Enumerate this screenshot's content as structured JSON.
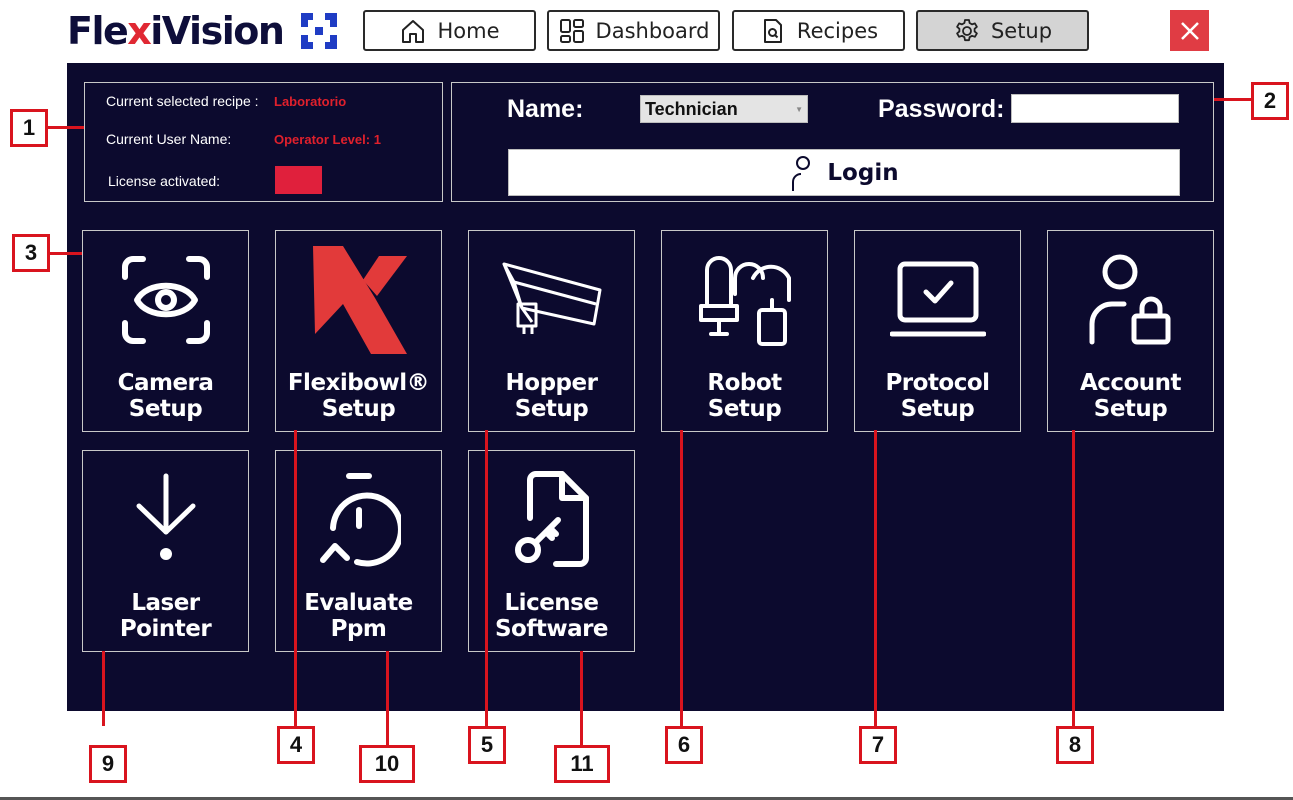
{
  "app": {
    "logo_text_part1": "Fle",
    "logo_text_x": "x",
    "logo_text_part2": "iVision",
    "brand_color": "#e02833",
    "panel_color": "#0c0a2e"
  },
  "nav": {
    "items": [
      {
        "label": "Home",
        "icon": "home-icon",
        "active": false
      },
      {
        "label": "Dashboard",
        "icon": "dashboard-icon",
        "active": false
      },
      {
        "label": "Recipes",
        "icon": "recipes-icon",
        "active": false
      },
      {
        "label": "Setup",
        "icon": "gear-icon",
        "active": true
      }
    ],
    "close_icon": "close-icon"
  },
  "info": {
    "recipe_label": "Current selected recipe :",
    "recipe_value": "Laboratorio",
    "user_label": "Current User Name:",
    "user_value": "Operator Level: 1",
    "license_label": "License activated:",
    "license_status_color": "#e0203c"
  },
  "login": {
    "name_label": "Name:",
    "name_value": "Technician",
    "password_label": "Password:",
    "password_value": "",
    "button_label": "Login",
    "button_icon": "user-icon"
  },
  "tiles": [
    {
      "line1": "Camera",
      "line2": "Setup",
      "icon": "camera-eye-icon"
    },
    {
      "line1": "Flexibowl®",
      "line2": "Setup",
      "icon": "flexibowl-logo-icon"
    },
    {
      "line1": "Hopper",
      "line2": "Setup",
      "icon": "hopper-icon"
    },
    {
      "line1": "Robot",
      "line2": "Setup",
      "icon": "robot-icon"
    },
    {
      "line1": "Protocol",
      "line2": "Setup",
      "icon": "laptop-check-icon"
    },
    {
      "line1": "Account",
      "line2": "Setup",
      "icon": "user-lock-icon"
    },
    {
      "line1": "Laser",
      "line2": "Pointer",
      "icon": "laser-arrow-icon"
    },
    {
      "line1": "Evaluate",
      "line2": "Ppm",
      "icon": "stopwatch-icon"
    },
    {
      "line1": "License",
      "line2": "Software",
      "icon": "license-file-icon"
    }
  ],
  "callouts": [
    "1",
    "2",
    "3",
    "4",
    "5",
    "6",
    "7",
    "8",
    "9",
    "10",
    "11"
  ]
}
